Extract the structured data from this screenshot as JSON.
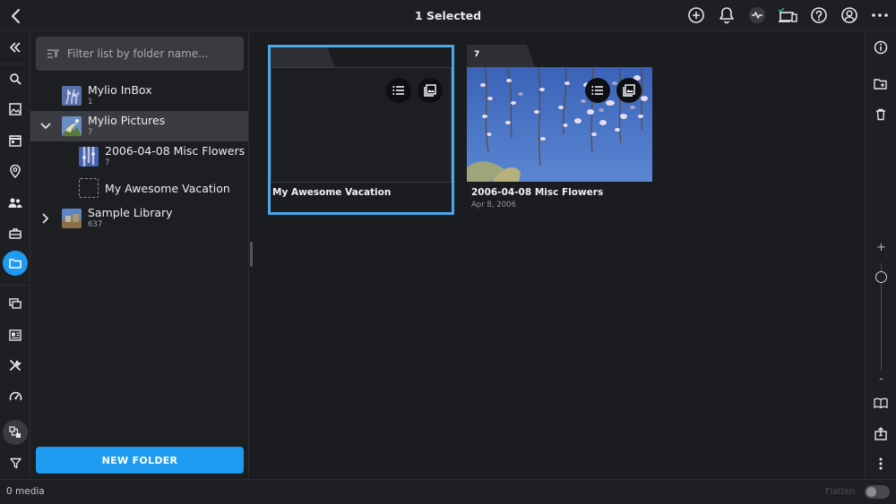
{
  "topbar": {
    "title": "1 Selected",
    "icons": [
      "back-icon",
      "add-circle-icon",
      "bell-icon",
      "activity-icon",
      "devices-icon",
      "help-icon",
      "account-icon",
      "more-icon"
    ]
  },
  "left_rail": {
    "icons": [
      "collapse-icon",
      "search-icon",
      "photo-icon",
      "calendar-icon",
      "map-pin-icon",
      "people-icon",
      "suitcase-icon",
      "folder-icon",
      "stack-icon",
      "layout-icon",
      "tools-icon",
      "dashboard-icon",
      "sources-icon",
      "filter-icon"
    ],
    "active": "folder-icon"
  },
  "folder_panel": {
    "filter_placeholder": "Filter list by folder name...",
    "items": [
      {
        "name": "Mylio InBox",
        "count": "1"
      },
      {
        "name": "Mylio Pictures",
        "count": "7"
      },
      {
        "name": "2006-04-08 Misc Flowers",
        "count": "7"
      },
      {
        "name": "My Awesome Vacation",
        "count": ""
      },
      {
        "name": "Sample Library",
        "count": "637"
      }
    ],
    "new_folder_label": "NEW FOLDER"
  },
  "main": {
    "cards": [
      {
        "tab_label": "",
        "title": "My Awesome Vacation",
        "subtitle": "",
        "selected": true
      },
      {
        "tab_label": "7",
        "title": "2006-04-08 Misc Flowers",
        "subtitle": "Apr 8, 2006",
        "selected": false
      }
    ]
  },
  "right_rail": {
    "icons": [
      "info-icon",
      "folder-add-icon",
      "trash-icon",
      "zoom-in-icon",
      "zoom-out-icon",
      "book-icon",
      "export-icon",
      "more-vertical-icon"
    ],
    "zoom_plus": "+",
    "zoom_minus": "-"
  },
  "status": {
    "media_count": "0 media",
    "flatten_label": "Flatten",
    "flatten_on": false
  },
  "colors": {
    "accent": "#1e9af0",
    "selection": "#49a8ec",
    "background": "#1b1c20",
    "panel": "#1d1e22",
    "selected_row": "#3b3c41"
  }
}
